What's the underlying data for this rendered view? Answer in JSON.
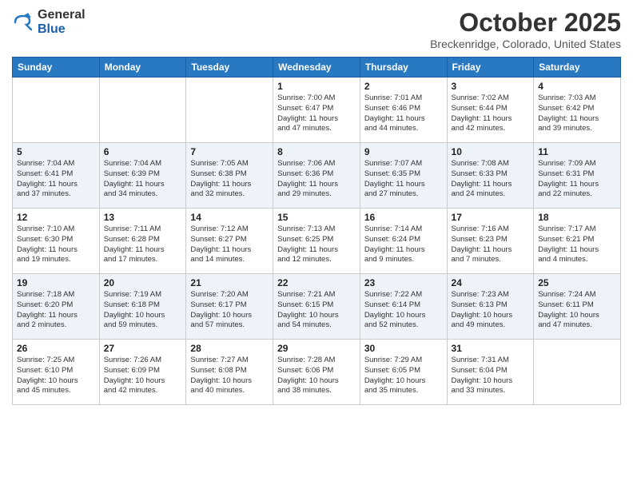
{
  "logo": {
    "general": "General",
    "blue": "Blue"
  },
  "title": "October 2025",
  "subtitle": "Breckenridge, Colorado, United States",
  "days_of_week": [
    "Sunday",
    "Monday",
    "Tuesday",
    "Wednesday",
    "Thursday",
    "Friday",
    "Saturday"
  ],
  "weeks": [
    [
      {
        "day": "",
        "info": ""
      },
      {
        "day": "",
        "info": ""
      },
      {
        "day": "",
        "info": ""
      },
      {
        "day": "1",
        "info": "Sunrise: 7:00 AM\nSunset: 6:47 PM\nDaylight: 11 hours\nand 47 minutes."
      },
      {
        "day": "2",
        "info": "Sunrise: 7:01 AM\nSunset: 6:46 PM\nDaylight: 11 hours\nand 44 minutes."
      },
      {
        "day": "3",
        "info": "Sunrise: 7:02 AM\nSunset: 6:44 PM\nDaylight: 11 hours\nand 42 minutes."
      },
      {
        "day": "4",
        "info": "Sunrise: 7:03 AM\nSunset: 6:42 PM\nDaylight: 11 hours\nand 39 minutes."
      }
    ],
    [
      {
        "day": "5",
        "info": "Sunrise: 7:04 AM\nSunset: 6:41 PM\nDaylight: 11 hours\nand 37 minutes."
      },
      {
        "day": "6",
        "info": "Sunrise: 7:04 AM\nSunset: 6:39 PM\nDaylight: 11 hours\nand 34 minutes."
      },
      {
        "day": "7",
        "info": "Sunrise: 7:05 AM\nSunset: 6:38 PM\nDaylight: 11 hours\nand 32 minutes."
      },
      {
        "day": "8",
        "info": "Sunrise: 7:06 AM\nSunset: 6:36 PM\nDaylight: 11 hours\nand 29 minutes."
      },
      {
        "day": "9",
        "info": "Sunrise: 7:07 AM\nSunset: 6:35 PM\nDaylight: 11 hours\nand 27 minutes."
      },
      {
        "day": "10",
        "info": "Sunrise: 7:08 AM\nSunset: 6:33 PM\nDaylight: 11 hours\nand 24 minutes."
      },
      {
        "day": "11",
        "info": "Sunrise: 7:09 AM\nSunset: 6:31 PM\nDaylight: 11 hours\nand 22 minutes."
      }
    ],
    [
      {
        "day": "12",
        "info": "Sunrise: 7:10 AM\nSunset: 6:30 PM\nDaylight: 11 hours\nand 19 minutes."
      },
      {
        "day": "13",
        "info": "Sunrise: 7:11 AM\nSunset: 6:28 PM\nDaylight: 11 hours\nand 17 minutes."
      },
      {
        "day": "14",
        "info": "Sunrise: 7:12 AM\nSunset: 6:27 PM\nDaylight: 11 hours\nand 14 minutes."
      },
      {
        "day": "15",
        "info": "Sunrise: 7:13 AM\nSunset: 6:25 PM\nDaylight: 11 hours\nand 12 minutes."
      },
      {
        "day": "16",
        "info": "Sunrise: 7:14 AM\nSunset: 6:24 PM\nDaylight: 11 hours\nand 9 minutes."
      },
      {
        "day": "17",
        "info": "Sunrise: 7:16 AM\nSunset: 6:23 PM\nDaylight: 11 hours\nand 7 minutes."
      },
      {
        "day": "18",
        "info": "Sunrise: 7:17 AM\nSunset: 6:21 PM\nDaylight: 11 hours\nand 4 minutes."
      }
    ],
    [
      {
        "day": "19",
        "info": "Sunrise: 7:18 AM\nSunset: 6:20 PM\nDaylight: 11 hours\nand 2 minutes."
      },
      {
        "day": "20",
        "info": "Sunrise: 7:19 AM\nSunset: 6:18 PM\nDaylight: 10 hours\nand 59 minutes."
      },
      {
        "day": "21",
        "info": "Sunrise: 7:20 AM\nSunset: 6:17 PM\nDaylight: 10 hours\nand 57 minutes."
      },
      {
        "day": "22",
        "info": "Sunrise: 7:21 AM\nSunset: 6:15 PM\nDaylight: 10 hours\nand 54 minutes."
      },
      {
        "day": "23",
        "info": "Sunrise: 7:22 AM\nSunset: 6:14 PM\nDaylight: 10 hours\nand 52 minutes."
      },
      {
        "day": "24",
        "info": "Sunrise: 7:23 AM\nSunset: 6:13 PM\nDaylight: 10 hours\nand 49 minutes."
      },
      {
        "day": "25",
        "info": "Sunrise: 7:24 AM\nSunset: 6:11 PM\nDaylight: 10 hours\nand 47 minutes."
      }
    ],
    [
      {
        "day": "26",
        "info": "Sunrise: 7:25 AM\nSunset: 6:10 PM\nDaylight: 10 hours\nand 45 minutes."
      },
      {
        "day": "27",
        "info": "Sunrise: 7:26 AM\nSunset: 6:09 PM\nDaylight: 10 hours\nand 42 minutes."
      },
      {
        "day": "28",
        "info": "Sunrise: 7:27 AM\nSunset: 6:08 PM\nDaylight: 10 hours\nand 40 minutes."
      },
      {
        "day": "29",
        "info": "Sunrise: 7:28 AM\nSunset: 6:06 PM\nDaylight: 10 hours\nand 38 minutes."
      },
      {
        "day": "30",
        "info": "Sunrise: 7:29 AM\nSunset: 6:05 PM\nDaylight: 10 hours\nand 35 minutes."
      },
      {
        "day": "31",
        "info": "Sunrise: 7:31 AM\nSunset: 6:04 PM\nDaylight: 10 hours\nand 33 minutes."
      },
      {
        "day": "",
        "info": ""
      }
    ]
  ],
  "row_styles": [
    "norm",
    "alt",
    "norm",
    "alt",
    "norm"
  ]
}
